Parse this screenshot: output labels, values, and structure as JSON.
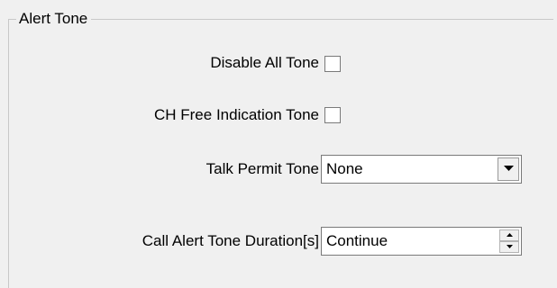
{
  "group": {
    "title": "Alert Tone"
  },
  "fields": {
    "disable_all_tone": {
      "label": "Disable All Tone",
      "checked": false
    },
    "ch_free_indication_tone": {
      "label": "CH Free Indication Tone",
      "checked": false
    },
    "talk_permit_tone": {
      "label": "Talk Permit Tone",
      "value": "None"
    },
    "call_alert_tone_duration": {
      "label": "Call Alert Tone Duration[s]",
      "value": "Continue"
    }
  },
  "icons": {
    "dropdown": "chevron-down-icon",
    "spin_up": "spin-up-icon",
    "spin_down": "spin-down-icon"
  },
  "colors": {
    "background": "#f0f0f0",
    "field_background": "#ffffff",
    "border": "#7a7a7a",
    "group_border": "#c8c8c8"
  }
}
